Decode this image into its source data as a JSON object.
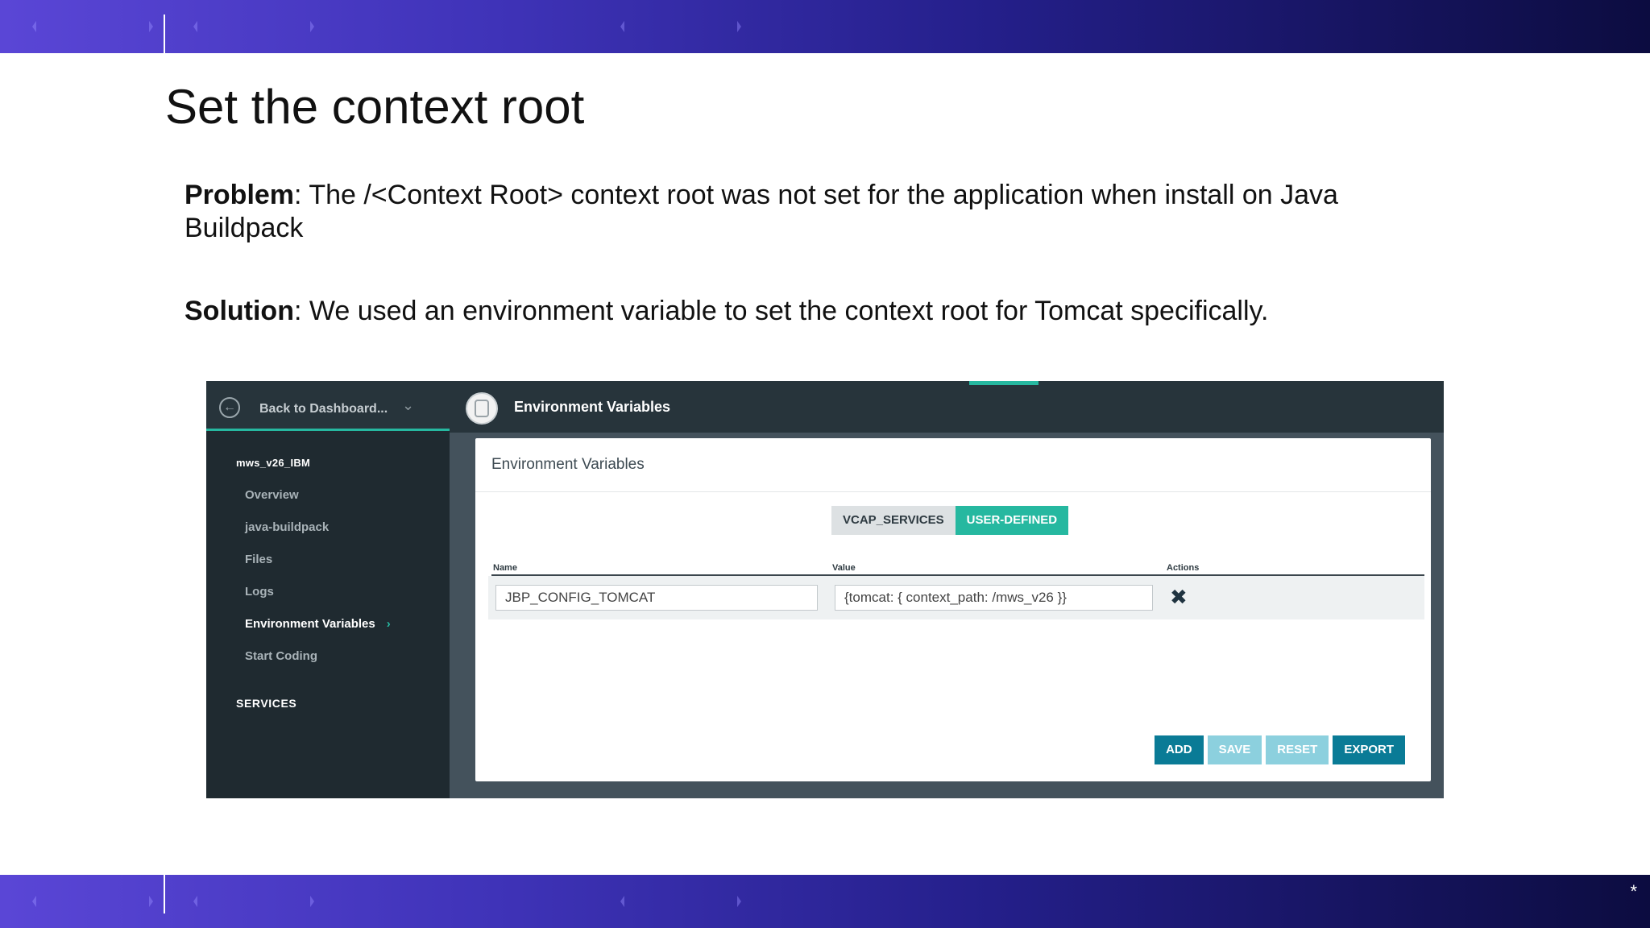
{
  "slide": {
    "title": "Set the context root",
    "problem_label": "Problem",
    "problem_text": ": The /<Context Root> context root was not set for the application when install on Java Buildpack",
    "solution_label": "Solution",
    "solution_text": ": We used an environment variable to set the context root for Tomcat specifically.",
    "corner_mark": "*"
  },
  "app": {
    "back_label": "Back to Dashboard...",
    "header_title": "Environment Variables",
    "app_name": "mws_v26_IBM",
    "nav": [
      {
        "label": "Overview"
      },
      {
        "label": "java-buildpack"
      },
      {
        "label": "Files"
      },
      {
        "label": "Logs"
      },
      {
        "label": "Environment Variables"
      },
      {
        "label": "Start Coding"
      }
    ],
    "services_label": "SERVICES",
    "card": {
      "title": "Environment Variables",
      "tabs": [
        "VCAP_SERVICES",
        "USER-DEFINED"
      ],
      "columns": [
        "Name",
        "Value",
        "Actions"
      ],
      "rows": [
        {
          "name": "JBP_CONFIG_TOMCAT",
          "value": "{tomcat: { context_path: /mws_v26 }}"
        }
      ],
      "buttons": [
        "ADD",
        "SAVE",
        "RESET",
        "EXPORT"
      ]
    }
  },
  "colors": {
    "accent": "#26b8a0",
    "primary_button": "#0a7b96",
    "disabled_button": "#8cd0de",
    "sidebar": "#1f2a30"
  },
  "icons": {
    "back": "arrow-left-circle-icon",
    "dropdown": "chevron-down-icon",
    "app": "app-badge-icon",
    "active_nav": "chevron-right-icon",
    "delete": "close-x-icon"
  }
}
